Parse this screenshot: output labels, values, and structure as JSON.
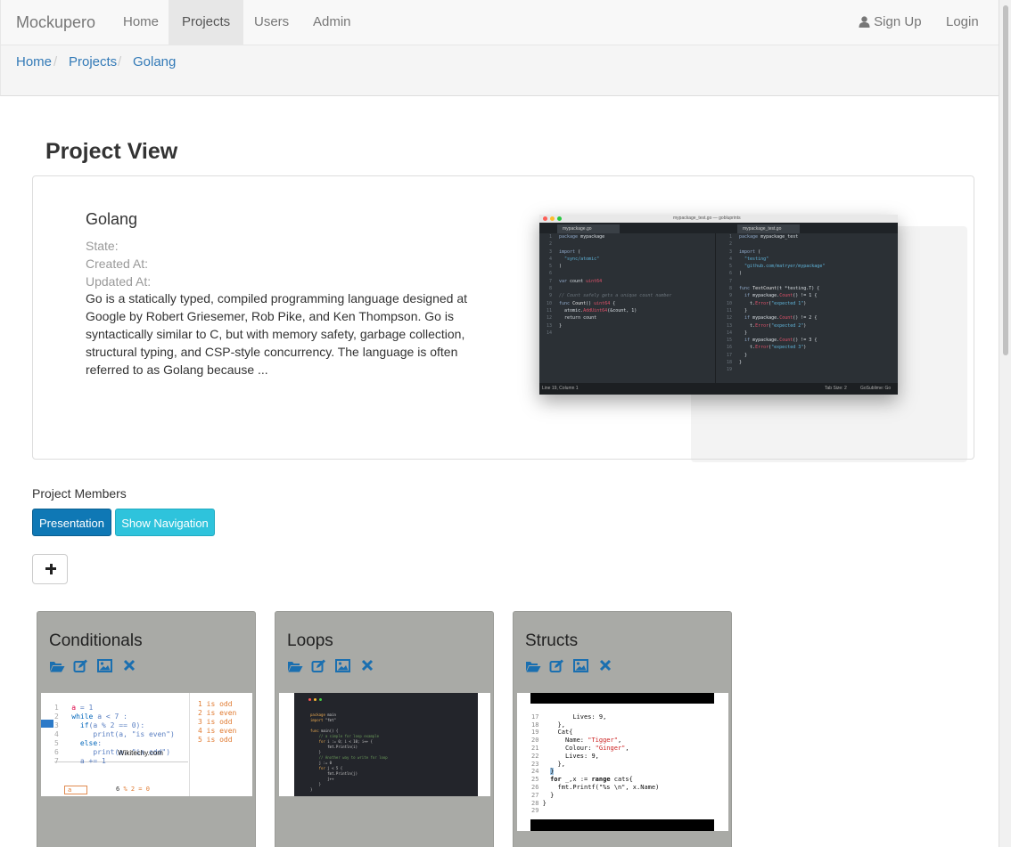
{
  "navbar": {
    "brand": "Mockupero",
    "items": [
      {
        "label": "Home",
        "active": false
      },
      {
        "label": "Projects",
        "active": true
      },
      {
        "label": "Users",
        "active": false
      },
      {
        "label": "Admin",
        "active": false
      }
    ],
    "signup_label": "Sign Up",
    "login_label": "Login"
  },
  "breadcrumb": [
    "Home",
    "Projects",
    "Golang"
  ],
  "breadcrumb_separator": "/",
  "page_title": "Project View",
  "project": {
    "name": "Golang",
    "state_label": "State:",
    "created_label": "Created At:",
    "updated_label": "Updated At:",
    "description": "Go is a statically typed, compiled programming language designed at Google by Robert Griesemer, Rob Pike, and Ken Thompson. Go is syntactically similar to C, but with memory safety, garbage collection, structural typing, and CSP-style concurrency. The language is often referred to as Golang because ...",
    "image": {
      "window_title": "mypackage_test.go — gobluprints",
      "tab_left": "mypackage.go",
      "tab_right": "mypackage_test.go",
      "status_left": "Line 19, Column 1",
      "status_tab": "Tab Size: 2",
      "status_syntax": "GoSublime: Go"
    }
  },
  "members_title": "Project Members",
  "buttons": {
    "presentation": "Presentation",
    "show_navigation": "Show Navigation"
  },
  "cards": [
    {
      "title": "Conditionals",
      "watermark": "Wikitechy.com"
    },
    {
      "title": "Loops"
    },
    {
      "title": "Structs"
    }
  ],
  "colors": {
    "link": "#337ab7",
    "primary_button": "#0f78b5",
    "info_button": "#2ec3dc",
    "card_bg": "#a9aaa6",
    "card_icon": "#1a6fb0"
  }
}
